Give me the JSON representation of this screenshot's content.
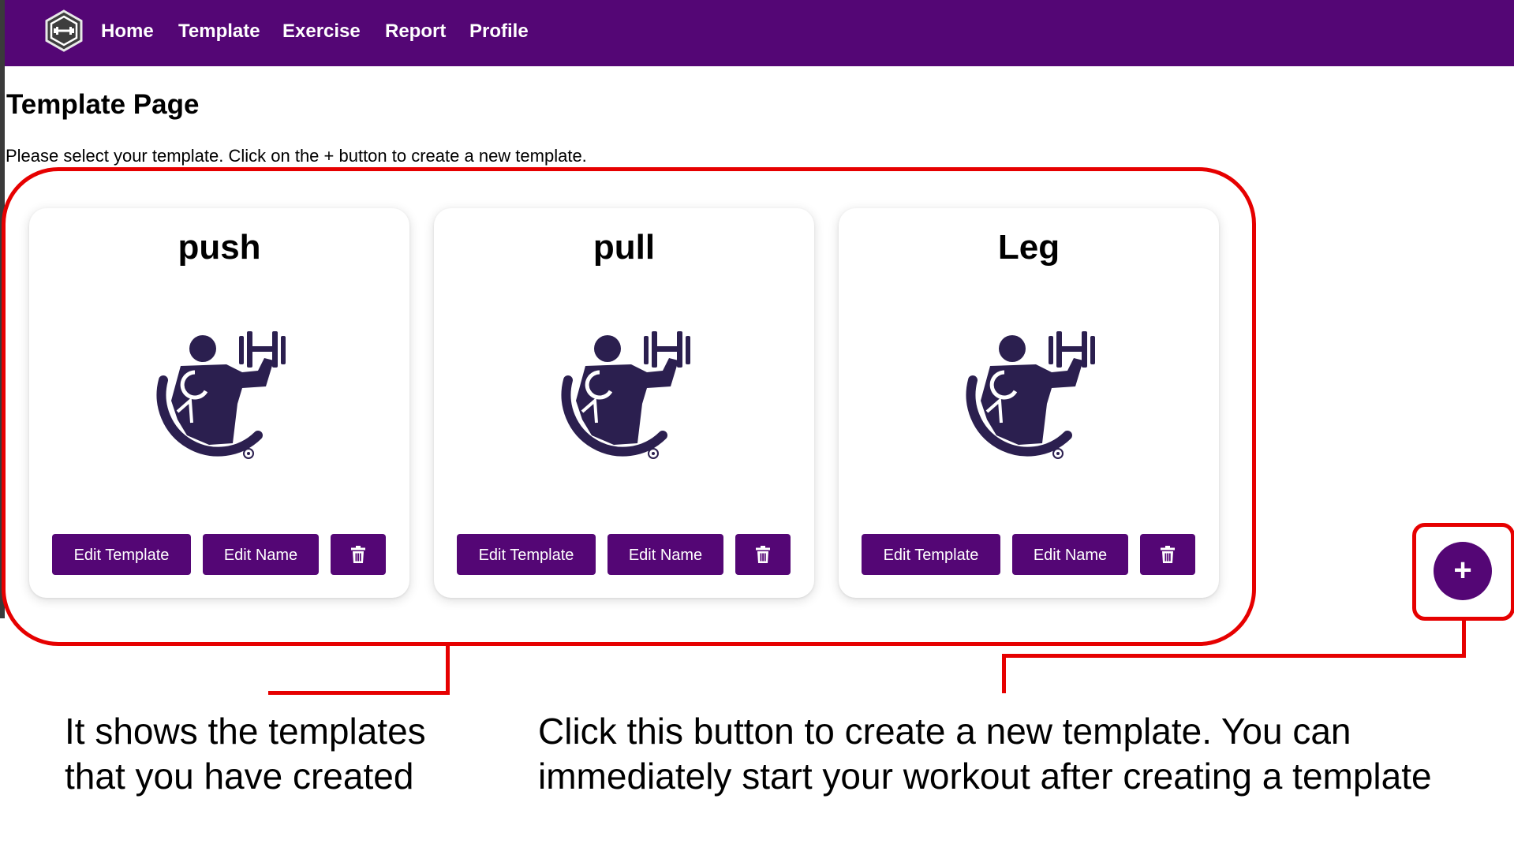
{
  "nav": {
    "links": [
      "Home",
      "Template",
      "Exercise",
      "Report",
      "Profile"
    ]
  },
  "page": {
    "title": "Template Page",
    "description": "Please select your template. Click on the + button to create a new template."
  },
  "templates": [
    {
      "name": "push",
      "edit_template_label": "Edit Template",
      "edit_name_label": "Edit Name",
      "delete_icon": "trash-icon"
    },
    {
      "name": "pull",
      "edit_template_label": "Edit Template",
      "edit_name_label": "Edit Name",
      "delete_icon": "trash-icon"
    },
    {
      "name": "Leg",
      "edit_template_label": "Edit Template",
      "edit_name_label": "Edit Name",
      "delete_icon": "trash-icon"
    }
  ],
  "add_button": {
    "label": "+"
  },
  "annotations": {
    "templates_note_line1": "It shows the templates",
    "templates_note_line2": "that you have created",
    "add_note_line1": "Click this button to create a new template. You can",
    "add_note_line2": "immediately start your workout after creating a template"
  },
  "colors": {
    "brand": "#540675",
    "callout": "#e60000",
    "icon": "#2b1f4f"
  },
  "icons": {
    "logo": "hexagon-dumbbell-logo",
    "card_image": "bodybuilder-dumbbell-icon"
  }
}
